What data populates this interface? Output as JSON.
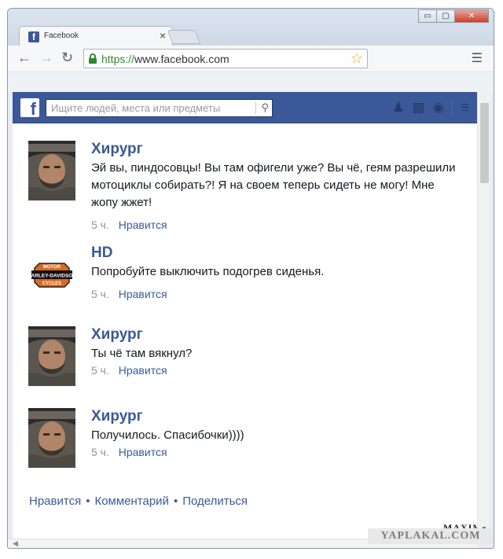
{
  "browser": {
    "tab_title": "Facebook",
    "tab_close": "×",
    "url_proto": "https://",
    "url_rest": "www.facebook.com",
    "window_buttons": [
      "▭",
      "▢",
      "✕"
    ]
  },
  "fb": {
    "logo": "f",
    "search_placeholder": "Ищите людей, места или предметы",
    "accent": "#3b5998"
  },
  "posts": [
    {
      "author": "Хирург",
      "avatar": "bearded-man-avatar",
      "text": "Эй вы, пиндосовцы! Вы там офигели уже? Вы чё, геям разрешили мотоциклы собирать?! Я на своем теперь сидеть не могу! Мне жопу жжет!",
      "time": "5 ч.",
      "like": "Нравится"
    },
    {
      "author": "HD",
      "avatar": "harley-davidson-logo",
      "text": "Попробуйте выключить подогрев сиденья.",
      "time": "5 ч.",
      "like": "Нравится"
    },
    {
      "author": "Хирург",
      "avatar": "bearded-man-avatar",
      "text": "Ты чё там вякнул?",
      "time": "5 ч.",
      "like": "Нравится"
    },
    {
      "author": "Хирург",
      "avatar": "bearded-man-avatar",
      "text": "Получилось. Спасибочки))))",
      "time": "5 ч.",
      "like": "Нравится"
    }
  ],
  "footer": {
    "like": "Нравится",
    "comment": "Комментарий",
    "share": "Поделиться",
    "separator": "•"
  },
  "overlays": {
    "maxim": "MAXIM",
    "watermark": "YAPLAKAL.COM"
  }
}
